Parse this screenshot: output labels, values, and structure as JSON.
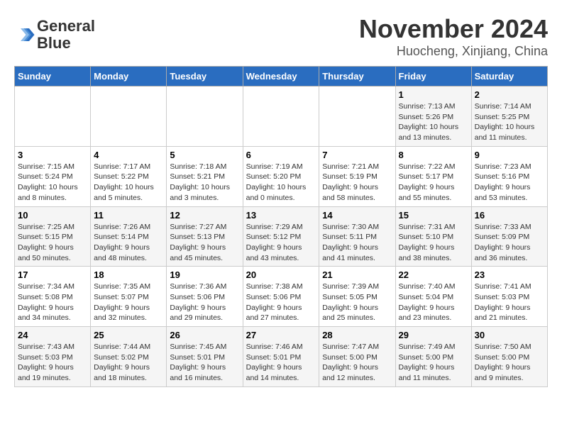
{
  "header": {
    "logo_line1": "General",
    "logo_line2": "Blue",
    "month_title": "November 2024",
    "location": "Huocheng, Xinjiang, China"
  },
  "calendar": {
    "days_of_week": [
      "Sunday",
      "Monday",
      "Tuesday",
      "Wednesday",
      "Thursday",
      "Friday",
      "Saturday"
    ],
    "weeks": [
      [
        {
          "day": "",
          "info": ""
        },
        {
          "day": "",
          "info": ""
        },
        {
          "day": "",
          "info": ""
        },
        {
          "day": "",
          "info": ""
        },
        {
          "day": "",
          "info": ""
        },
        {
          "day": "1",
          "info": "Sunrise: 7:13 AM\nSunset: 5:26 PM\nDaylight: 10 hours and 13 minutes."
        },
        {
          "day": "2",
          "info": "Sunrise: 7:14 AM\nSunset: 5:25 PM\nDaylight: 10 hours and 11 minutes."
        }
      ],
      [
        {
          "day": "3",
          "info": "Sunrise: 7:15 AM\nSunset: 5:24 PM\nDaylight: 10 hours and 8 minutes."
        },
        {
          "day": "4",
          "info": "Sunrise: 7:17 AM\nSunset: 5:22 PM\nDaylight: 10 hours and 5 minutes."
        },
        {
          "day": "5",
          "info": "Sunrise: 7:18 AM\nSunset: 5:21 PM\nDaylight: 10 hours and 3 minutes."
        },
        {
          "day": "6",
          "info": "Sunrise: 7:19 AM\nSunset: 5:20 PM\nDaylight: 10 hours and 0 minutes."
        },
        {
          "day": "7",
          "info": "Sunrise: 7:21 AM\nSunset: 5:19 PM\nDaylight: 9 hours and 58 minutes."
        },
        {
          "day": "8",
          "info": "Sunrise: 7:22 AM\nSunset: 5:17 PM\nDaylight: 9 hours and 55 minutes."
        },
        {
          "day": "9",
          "info": "Sunrise: 7:23 AM\nSunset: 5:16 PM\nDaylight: 9 hours and 53 minutes."
        }
      ],
      [
        {
          "day": "10",
          "info": "Sunrise: 7:25 AM\nSunset: 5:15 PM\nDaylight: 9 hours and 50 minutes."
        },
        {
          "day": "11",
          "info": "Sunrise: 7:26 AM\nSunset: 5:14 PM\nDaylight: 9 hours and 48 minutes."
        },
        {
          "day": "12",
          "info": "Sunrise: 7:27 AM\nSunset: 5:13 PM\nDaylight: 9 hours and 45 minutes."
        },
        {
          "day": "13",
          "info": "Sunrise: 7:29 AM\nSunset: 5:12 PM\nDaylight: 9 hours and 43 minutes."
        },
        {
          "day": "14",
          "info": "Sunrise: 7:30 AM\nSunset: 5:11 PM\nDaylight: 9 hours and 41 minutes."
        },
        {
          "day": "15",
          "info": "Sunrise: 7:31 AM\nSunset: 5:10 PM\nDaylight: 9 hours and 38 minutes."
        },
        {
          "day": "16",
          "info": "Sunrise: 7:33 AM\nSunset: 5:09 PM\nDaylight: 9 hours and 36 minutes."
        }
      ],
      [
        {
          "day": "17",
          "info": "Sunrise: 7:34 AM\nSunset: 5:08 PM\nDaylight: 9 hours and 34 minutes."
        },
        {
          "day": "18",
          "info": "Sunrise: 7:35 AM\nSunset: 5:07 PM\nDaylight: 9 hours and 32 minutes."
        },
        {
          "day": "19",
          "info": "Sunrise: 7:36 AM\nSunset: 5:06 PM\nDaylight: 9 hours and 29 minutes."
        },
        {
          "day": "20",
          "info": "Sunrise: 7:38 AM\nSunset: 5:06 PM\nDaylight: 9 hours and 27 minutes."
        },
        {
          "day": "21",
          "info": "Sunrise: 7:39 AM\nSunset: 5:05 PM\nDaylight: 9 hours and 25 minutes."
        },
        {
          "day": "22",
          "info": "Sunrise: 7:40 AM\nSunset: 5:04 PM\nDaylight: 9 hours and 23 minutes."
        },
        {
          "day": "23",
          "info": "Sunrise: 7:41 AM\nSunset: 5:03 PM\nDaylight: 9 hours and 21 minutes."
        }
      ],
      [
        {
          "day": "24",
          "info": "Sunrise: 7:43 AM\nSunset: 5:03 PM\nDaylight: 9 hours and 19 minutes."
        },
        {
          "day": "25",
          "info": "Sunrise: 7:44 AM\nSunset: 5:02 PM\nDaylight: 9 hours and 18 minutes."
        },
        {
          "day": "26",
          "info": "Sunrise: 7:45 AM\nSunset: 5:01 PM\nDaylight: 9 hours and 16 minutes."
        },
        {
          "day": "27",
          "info": "Sunrise: 7:46 AM\nSunset: 5:01 PM\nDaylight: 9 hours and 14 minutes."
        },
        {
          "day": "28",
          "info": "Sunrise: 7:47 AM\nSunset: 5:00 PM\nDaylight: 9 hours and 12 minutes."
        },
        {
          "day": "29",
          "info": "Sunrise: 7:49 AM\nSunset: 5:00 PM\nDaylight: 9 hours and 11 minutes."
        },
        {
          "day": "30",
          "info": "Sunrise: 7:50 AM\nSunset: 5:00 PM\nDaylight: 9 hours and 9 minutes."
        }
      ]
    ]
  }
}
